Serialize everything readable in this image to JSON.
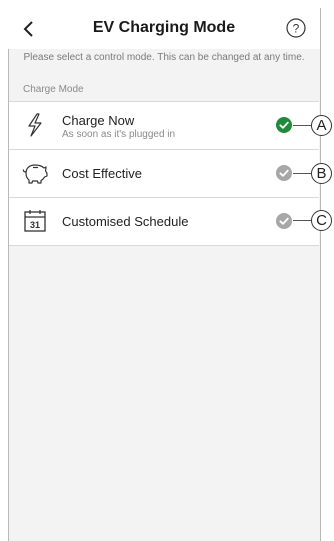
{
  "header": {
    "title": "EV Charging Mode",
    "back_icon": "chevron-left-icon",
    "help_icon": "question-circle-icon"
  },
  "info_text": "Please select a control mode. This can be changed at any time.",
  "section_label": "Charge Mode",
  "options": [
    {
      "title": "Charge Now",
      "subtitle": "As soon as it's plugged in",
      "icon": "lightning-bolt-icon",
      "status": "selected",
      "status_color": "#1f8a3a",
      "callout": "A"
    },
    {
      "title": "Cost Effective",
      "icon": "piggy-bank-icon",
      "status": "unselected",
      "status_color": "#a7a7a7",
      "callout": "B"
    },
    {
      "title": "Customised Schedule",
      "icon": "calendar-31-icon",
      "calendar_day": "31",
      "status": "unselected",
      "status_color": "#a7a7a7",
      "callout": "C"
    }
  ]
}
